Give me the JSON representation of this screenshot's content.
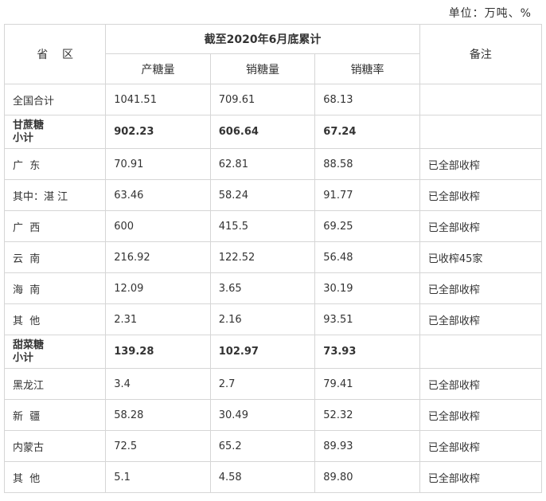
{
  "unit_label": "单位：万吨、%",
  "header": {
    "province": "省    区",
    "period": "截至2020年6月底累计",
    "production": "产糖量",
    "sales": "销糖量",
    "sales_rate": "销糖率",
    "note": "备注"
  },
  "rows": [
    {
      "type": "normal",
      "region": "全国合计",
      "production": "1041.51",
      "sales": "709.61",
      "rate": "68.13",
      "note": ""
    },
    {
      "type": "subtotal",
      "region_line1": "甘蔗糖",
      "region_line2": "小计",
      "production": "902.23",
      "sales": "606.64",
      "rate": "67.24",
      "note": ""
    },
    {
      "type": "normal",
      "region": "广  东",
      "production": "70.91",
      "sales": "62.81",
      "rate": "88.58",
      "note": "已全部收榨"
    },
    {
      "type": "normal",
      "region": "其中：湛 江",
      "production": "63.46",
      "sales": "58.24",
      "rate": "91.77",
      "note": "已全部收榨"
    },
    {
      "type": "normal",
      "region": "广  西",
      "production": "600",
      "sales": "415.5",
      "rate": "69.25",
      "note": "已全部收榨"
    },
    {
      "type": "normal",
      "region": "云  南",
      "production": "216.92",
      "sales": "122.52",
      "rate": "56.48",
      "note": "已收榨45家"
    },
    {
      "type": "normal",
      "region": "海  南",
      "production": "12.09",
      "sales": "3.65",
      "rate": "30.19",
      "note": "已全部收榨"
    },
    {
      "type": "normal",
      "region": "其  他",
      "production": "2.31",
      "sales": "2.16",
      "rate": "93.51",
      "note": "已全部收榨"
    },
    {
      "type": "subtotal",
      "region_line1": "甜菜糖",
      "region_line2": "小计",
      "production": "139.28",
      "sales": "102.97",
      "rate": "73.93",
      "note": ""
    },
    {
      "type": "normal",
      "region": "黑龙江",
      "production": "3.4",
      "sales": "2.7",
      "rate": "79.41",
      "note": "已全部收榨"
    },
    {
      "type": "normal",
      "region": "新  疆",
      "production": "58.28",
      "sales": "30.49",
      "rate": "52.32",
      "note": "已全部收榨"
    },
    {
      "type": "normal",
      "region": "内蒙古",
      "production": "72.5",
      "sales": "65.2",
      "rate": "89.93",
      "note": "已全部收榨"
    },
    {
      "type": "normal",
      "region": "其  他",
      "production": "5.1",
      "sales": "4.58",
      "rate": "89.80",
      "note": "已全部收榨"
    }
  ]
}
